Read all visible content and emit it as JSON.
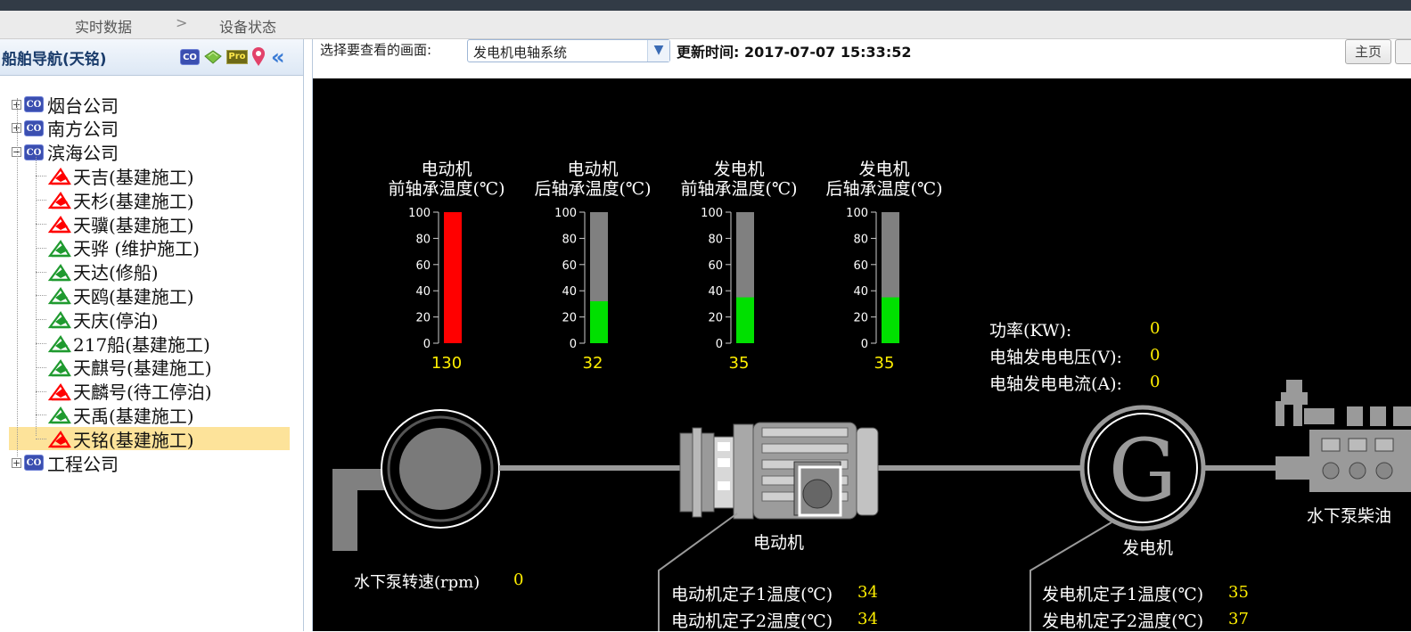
{
  "breadcrumb": {
    "item1": "实时数据",
    "sep": ">",
    "item2": "设备状态"
  },
  "sidebar": {
    "title": "船舶导航(天铭)",
    "toolbar_icons": [
      "co-icon",
      "map-icon",
      "pro-icon",
      "location-pin-icon",
      "collapse-icon"
    ],
    "co_badge": "CO",
    "pro_badge": "Pro",
    "collapse": "«",
    "tree": [
      {
        "label": "烟台公司",
        "type": "company",
        "expander": "+"
      },
      {
        "label": "南方公司",
        "type": "company",
        "expander": "+"
      },
      {
        "label": "滨海公司",
        "type": "company",
        "expander": "−"
      },
      {
        "label": "天吉(基建施工)",
        "type": "ship",
        "status": "red"
      },
      {
        "label": "天杉(基建施工)",
        "type": "ship",
        "status": "red"
      },
      {
        "label": "天骥(基建施工)",
        "type": "ship",
        "status": "red"
      },
      {
        "label": "天骅 (维护施工)",
        "type": "ship",
        "status": "green"
      },
      {
        "label": "天达(修船)",
        "type": "ship",
        "status": "green"
      },
      {
        "label": "天鸥(基建施工)",
        "type": "ship",
        "status": "green"
      },
      {
        "label": "天庆(停泊)",
        "type": "ship",
        "status": "green"
      },
      {
        "label": "217船(基建施工)",
        "type": "ship",
        "status": "green"
      },
      {
        "label": "天麒号(基建施工)",
        "type": "ship",
        "status": "green"
      },
      {
        "label": "天麟号(待工停泊)",
        "type": "ship",
        "status": "red"
      },
      {
        "label": "天禹(基建施工)",
        "type": "ship",
        "status": "green"
      },
      {
        "label": "天铭(基建施工)",
        "type": "ship",
        "status": "red",
        "selected": true
      },
      {
        "label": "工程公司",
        "type": "company",
        "expander": "+"
      }
    ]
  },
  "header": {
    "select_label": "选择要查看的画面:",
    "select_value": "发电机电轴系统",
    "update_label": "更新时间: 2017-07-07 15:33:52",
    "home_button": "主页"
  },
  "colors": {
    "alarm": "#ff0000",
    "normal": "#00e000",
    "value": "#ffee00",
    "selected_row": "#fde39a"
  },
  "gauges": [
    {
      "title1": "电动机",
      "title2": "前轴承温度(℃)",
      "value": 130,
      "display": "130",
      "max": 100,
      "color": "red"
    },
    {
      "title1": "电动机",
      "title2": "后轴承温度(℃)",
      "value": 32,
      "display": "32",
      "max": 100,
      "color": "green"
    },
    {
      "title1": "发电机",
      "title2": "前轴承温度(℃)",
      "value": 35,
      "display": "35",
      "max": 100,
      "color": "green"
    },
    {
      "title1": "发电机",
      "title2": "后轴承温度(℃)",
      "value": 35,
      "display": "35",
      "max": 100,
      "color": "green"
    }
  ],
  "gauge_ticks": [
    "100",
    "80",
    "60",
    "40",
    "20",
    "0"
  ],
  "power": {
    "power_label": "功率(KW):",
    "power_value": "0",
    "voltage_label": "电轴发电电压(V):",
    "voltage_value": "0",
    "current_label": "电轴发电电流(A):",
    "current_value": "0"
  },
  "diagram": {
    "motor_label": "电动机",
    "generator_label": "发电机",
    "generator_letter": "G",
    "diesel_label": "水下泵柴油",
    "pump_speed_label": "水下泵转速(rpm)",
    "pump_speed_value": "0"
  },
  "motor_temps": [
    {
      "label": "电动机定子1温度(℃)",
      "value": "34"
    },
    {
      "label": "电动机定子2温度(℃)",
      "value": "34"
    }
  ],
  "generator_temps": [
    {
      "label": "发电机定子1温度(℃)",
      "value": "35"
    },
    {
      "label": "发电机定子2温度(℃)",
      "value": "37"
    }
  ]
}
